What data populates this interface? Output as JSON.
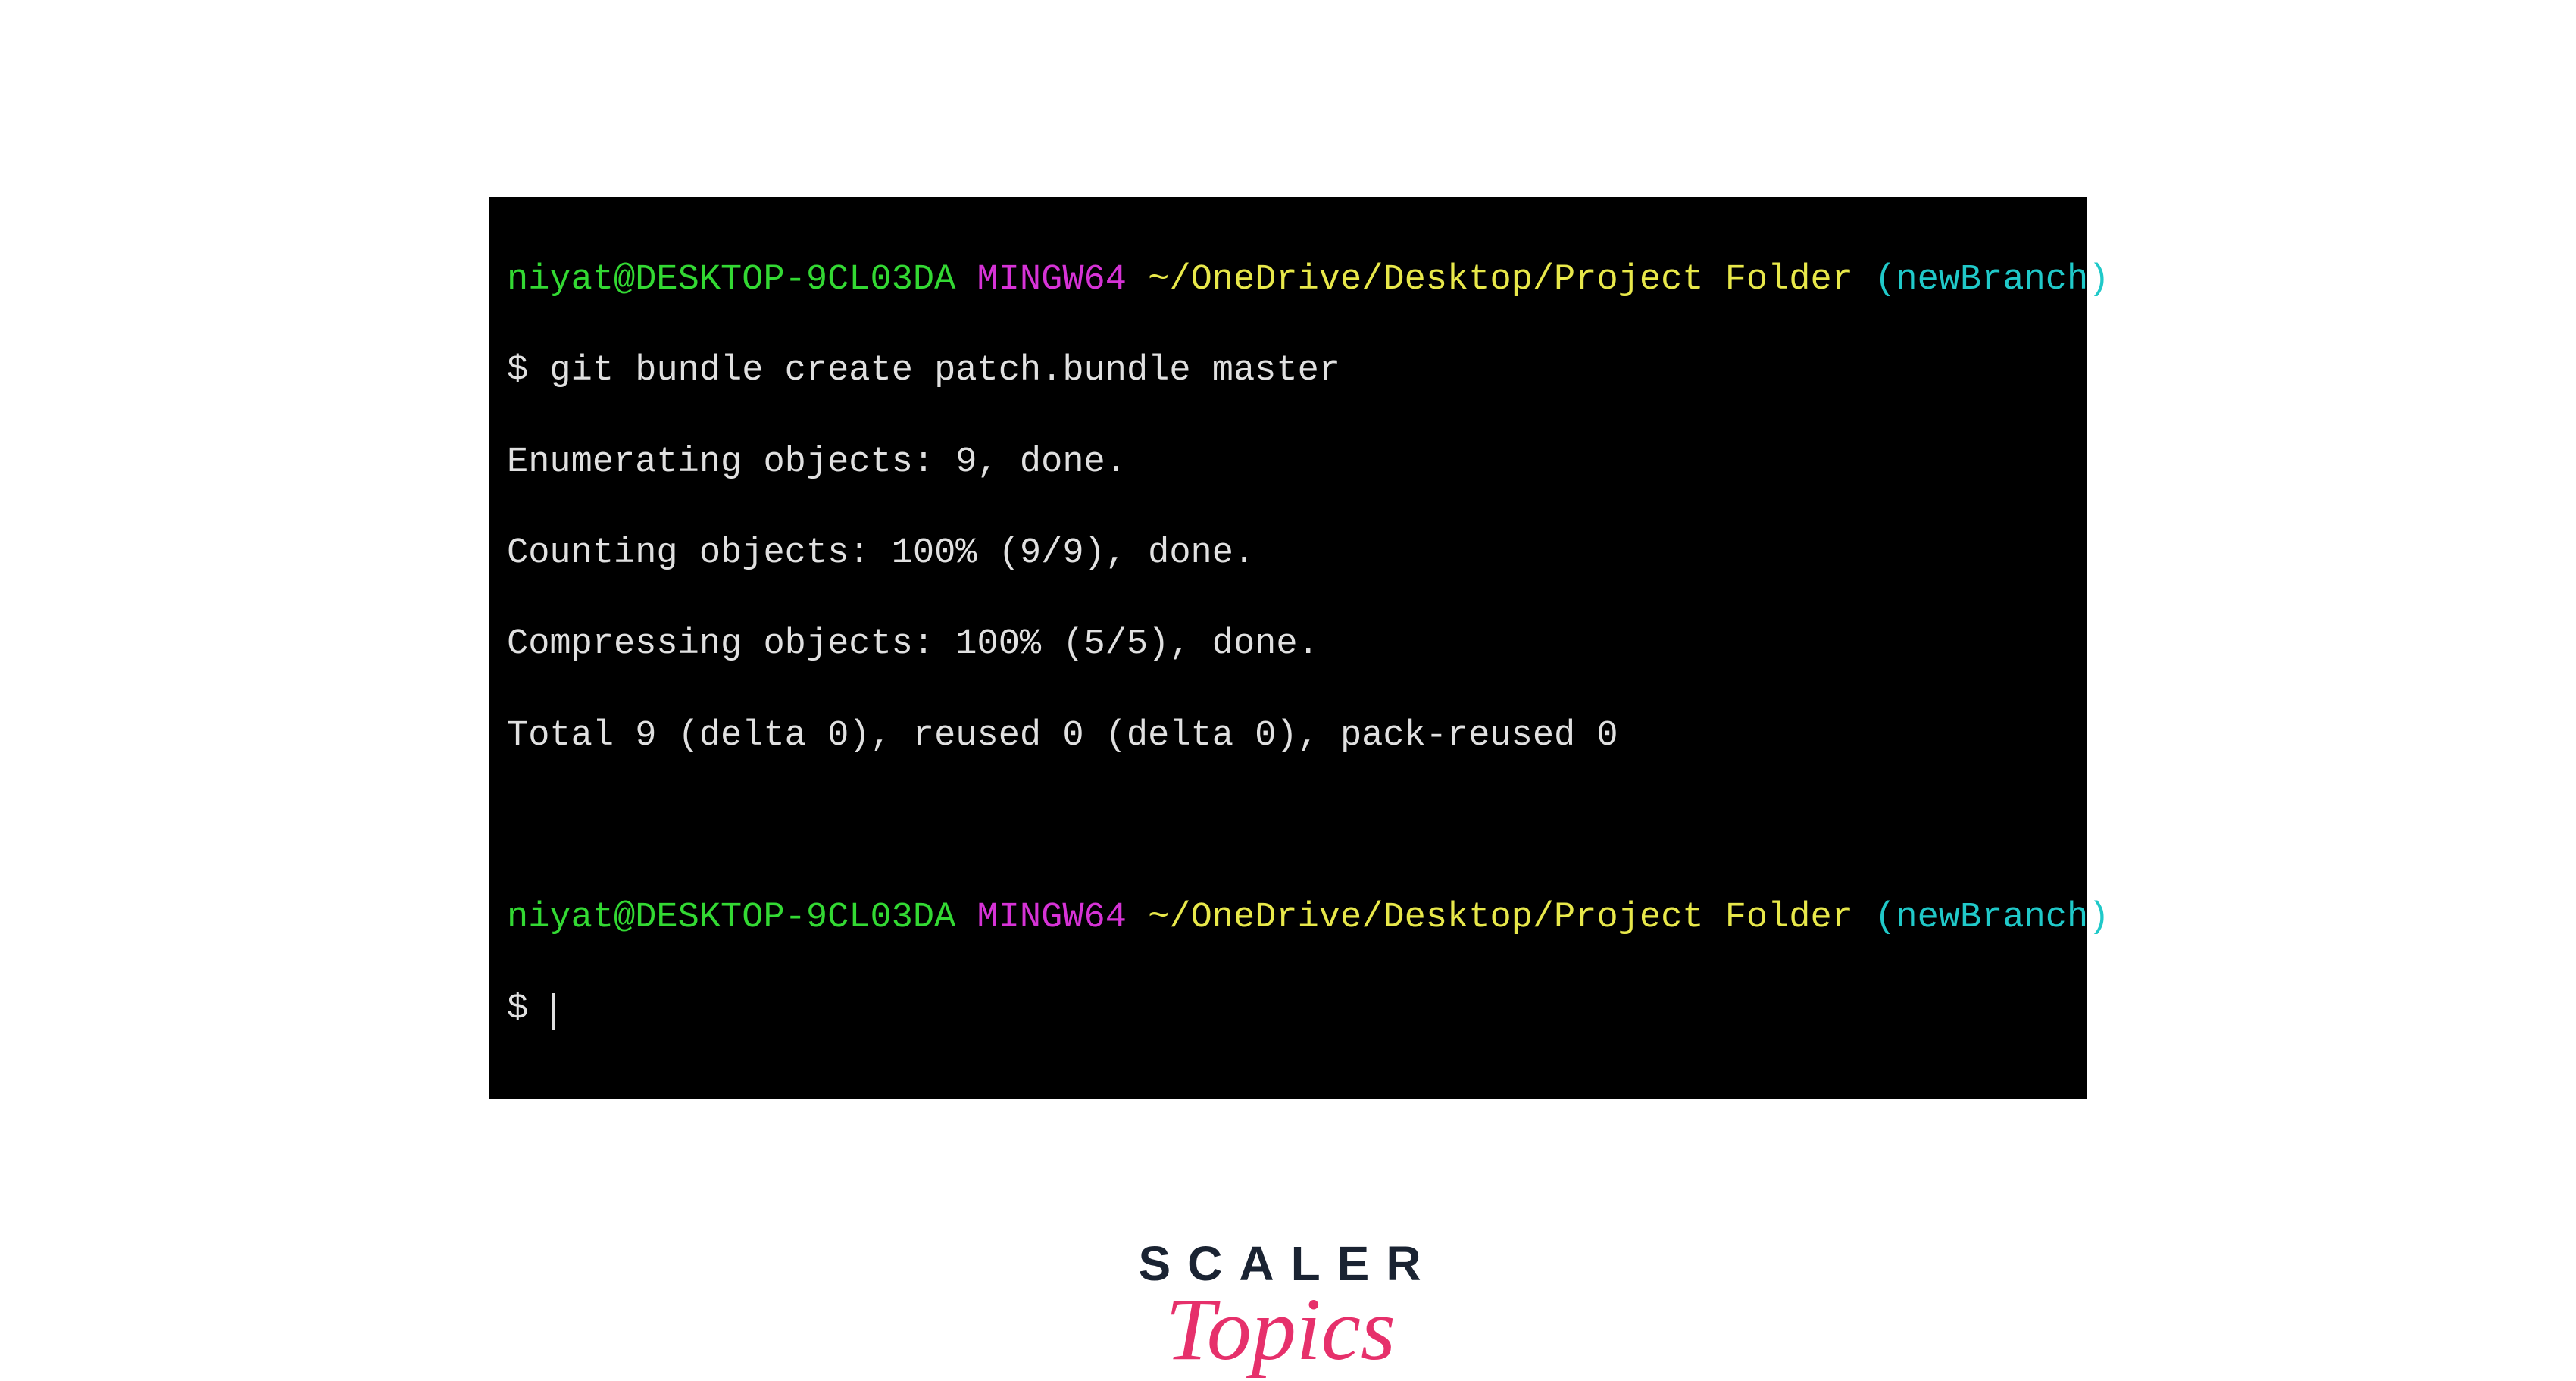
{
  "terminal": {
    "line1": {
      "user_host": "niyat@DESKTOP-9CL03DA",
      "mingw": "MINGW64",
      "path": "~/OneDrive/Desktop/Project Folder",
      "branch": "(newBranch)"
    },
    "prompt1": "$ ",
    "command1": "git bundle create patch.bundle master",
    "output": {
      "l1": "Enumerating objects: 9, done.",
      "l2": "Counting objects: 100% (9/9), done.",
      "l3": "Compressing objects: 100% (5/5), done.",
      "l4": "Total 9 (delta 0), reused 0 (delta 0), pack-reused 0"
    },
    "line2": {
      "user_host": "niyat@DESKTOP-9CL03DA",
      "mingw": "MINGW64",
      "path": "~/OneDrive/Desktop/Project Folder",
      "branch": "(newBranch)"
    },
    "prompt2": "$ "
  },
  "logo": {
    "main": "SCALER",
    "sub": "Topics"
  }
}
